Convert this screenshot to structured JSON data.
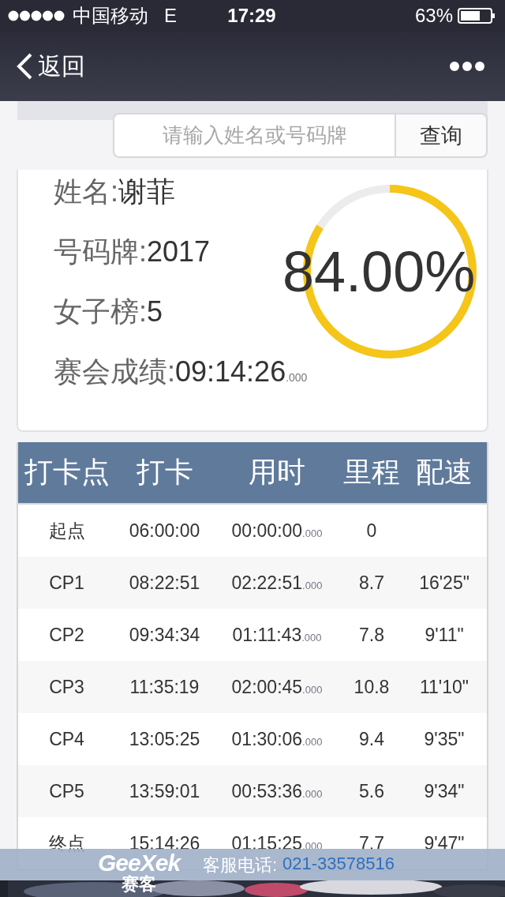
{
  "status_bar": {
    "carrier": "中国移动",
    "network": "E",
    "time": "17:29",
    "battery_percent": "63%"
  },
  "nav_bar": {
    "back_label": "返回"
  },
  "search": {
    "placeholder": "请输入姓名或号码牌",
    "button": "查询"
  },
  "runner": {
    "fields": [
      {
        "label": "姓名:",
        "value": "谢菲"
      },
      {
        "label": "号码牌:",
        "value": "2017"
      },
      {
        "label": "女子榜:",
        "value": "5"
      },
      {
        "label": "赛会成绩:",
        "value": "09:14:26",
        "suffix": ".000"
      }
    ],
    "progress": {
      "level": 0.84,
      "reading": "84.00%"
    }
  },
  "table": {
    "columns": [
      "打卡点",
      "打卡",
      "用时",
      "里程",
      "配速"
    ],
    "rows": [
      {
        "checkpoint": "起点",
        "clock": "06:00:00",
        "split": "00:00:00",
        "split_ms": ".000",
        "distance": "0"
      },
      {
        "checkpoint": "CP1",
        "clock": "08:22:51",
        "split": "02:22:51",
        "split_ms": ".000",
        "distance": "8.7",
        "pace": "16'25\""
      },
      {
        "checkpoint": "CP2",
        "clock": "09:34:34",
        "split": "01:11:43",
        "split_ms": ".000",
        "distance": "7.8",
        "pace": "9'11\""
      },
      {
        "checkpoint": "CP3",
        "clock": "11:35:19",
        "split": "02:00:45",
        "split_ms": ".000",
        "distance": "10.8",
        "pace": "11'10\""
      },
      {
        "checkpoint": "CP4",
        "clock": "13:05:25",
        "split": "01:30:06",
        "split_ms": ".000",
        "distance": "9.4",
        "pace": "9'35\""
      },
      {
        "checkpoint": "CP5",
        "clock": "13:59:01",
        "split": "00:53:36",
        "split_ms": ".000",
        "distance": "5.6",
        "pace": "9'34\""
      },
      {
        "checkpoint": "终点",
        "clock": "15:14:26",
        "split": "01:15:25",
        "split_ms": ".000",
        "distance": "7.7",
        "pace": "9'47\""
      }
    ]
  },
  "footer": {
    "logo_wordmark": "GeeXek",
    "logo_name": "赛客",
    "hotline_label": "客服电话:",
    "hotline_number": "021-33578516"
  }
}
